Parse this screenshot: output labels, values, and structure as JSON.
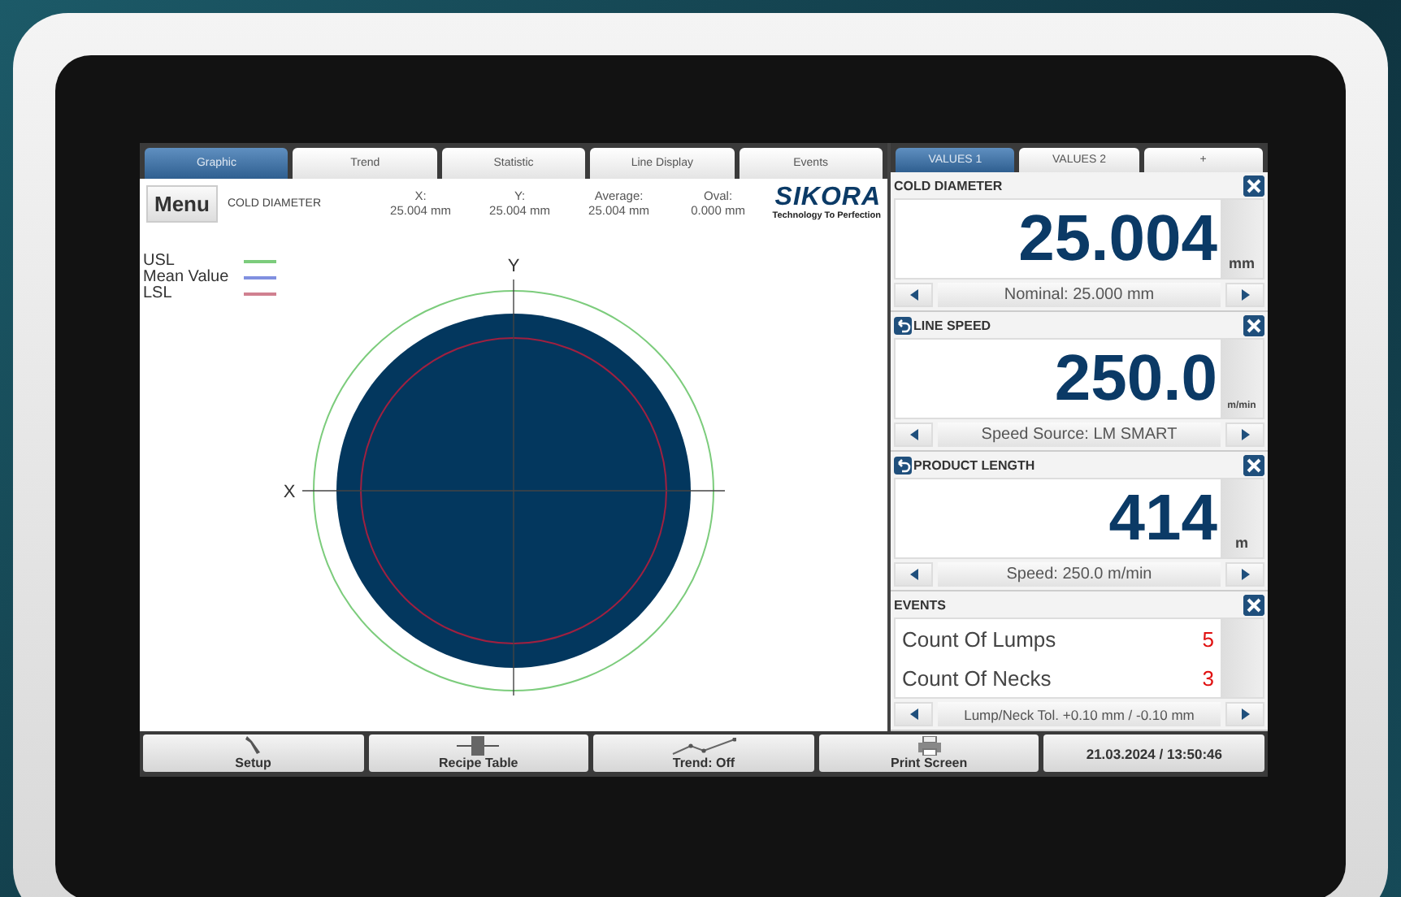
{
  "tabs": [
    {
      "label": "Graphic",
      "selected": true
    },
    {
      "label": "Trend",
      "selected": false
    },
    {
      "label": "Statistic",
      "selected": false
    },
    {
      "label": "Line Display",
      "selected": false
    },
    {
      "label": "Events",
      "selected": false
    }
  ],
  "header": {
    "menu": "Menu",
    "title": "COLD DIAMETER",
    "stats": [
      {
        "label": "X:",
        "value": "25.004 mm"
      },
      {
        "label": "Y:",
        "value": "25.004 mm"
      },
      {
        "label": "Average:",
        "value": "25.004 mm"
      },
      {
        "label": "Oval:",
        "value": "0.000 mm"
      }
    ],
    "logo": "SIKORA",
    "tagline": "Technology To Perfection"
  },
  "legend": [
    {
      "label": "USL",
      "color": "#7ccc7c"
    },
    {
      "label": "Mean Value",
      "color": "#8090e0"
    },
    {
      "label": "LSL",
      "color": "#d08090"
    }
  ],
  "axes": {
    "x": "X",
    "y": "Y"
  },
  "value_tabs": [
    {
      "label": "VALUES 1",
      "selected": true
    },
    {
      "label": "VALUES 2",
      "selected": false
    },
    {
      "label": "+",
      "selected": false
    }
  ],
  "cards": [
    {
      "title": "COLD DIAMETER",
      "back_icon": false,
      "value": "25.004",
      "unit": "mm",
      "footer": "Nominal: 25.000 mm"
    },
    {
      "title": "LINE SPEED",
      "back_icon": true,
      "value": "250.0",
      "unit": "m/min",
      "footer": "Speed Source: LM SMART"
    },
    {
      "title": "PRODUCT LENGTH",
      "back_icon": true,
      "value": "414",
      "unit": "m",
      "footer": "Speed: 250.0 m/min"
    }
  ],
  "events": {
    "title": "EVENTS",
    "rows": [
      {
        "label": "Count Of Lumps",
        "count": "5"
      },
      {
        "label": "Count Of Necks",
        "count": "3"
      }
    ],
    "footer": "Lump/Neck Tol. +0.10 mm / -0.10 mm"
  },
  "bottom_bar": [
    {
      "kind": "setup",
      "label": "Setup"
    },
    {
      "kind": "recipe",
      "label": "Recipe Table"
    },
    {
      "kind": "trend",
      "label": "Trend: Off"
    },
    {
      "kind": "print",
      "label": "Print Screen"
    }
  ],
  "datetime": "21.03.2024 / 13:50:46"
}
